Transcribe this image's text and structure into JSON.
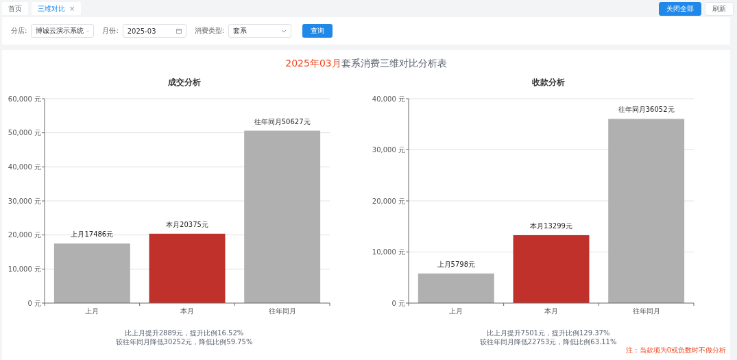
{
  "tabs": [
    {
      "label": "首页",
      "selected": false
    },
    {
      "label": "三维对比",
      "selected": true,
      "close_icon": "×"
    }
  ],
  "tab_actions": [
    {
      "label": "关闭全部",
      "kind": "primary"
    },
    {
      "label": "刷新",
      "kind": "plain"
    }
  ],
  "filters": [
    {
      "label": "分店:",
      "kind": "select",
      "value": "博诚云演示系统"
    },
    {
      "label": "月份:",
      "kind": "date",
      "value": "2025-03"
    },
    {
      "label": "消费类型:",
      "kind": "select",
      "value": "套系"
    }
  ],
  "query_button": "查询",
  "report_title": {
    "highlight": "2025年03月",
    "text": "套系消费三维对比分析表"
  },
  "charts": [
    {
      "chart_data": {
        "type": "bar",
        "title": "成交分析",
        "categories": [
          "上月",
          "本月",
          "往年同月"
        ],
        "stacked": true,
        "grid": true,
        "series": [
          {
            "color": "#afb0af",
            "values": [
              17486,
              null,
              50627
            ]
          },
          {
            "color": "#c1312c",
            "values": [
              null,
              20375,
              null
            ]
          }
        ],
        "value_labels": [
          "上月17486元",
          "本月20375元",
          "往年同月50627元"
        ],
        "ylim": [
          0,
          60000
        ],
        "yticks": [
          {
            "value": 0,
            "label": "0 元"
          },
          {
            "value": 10000,
            "label": "10,000 元"
          },
          {
            "value": 20000,
            "label": "20,000 元"
          },
          {
            "value": 30000,
            "label": "30,000 元"
          },
          {
            "value": 40000,
            "label": "40,000 元"
          },
          {
            "value": 50000,
            "label": "50,000 元"
          },
          {
            "value": 60000,
            "label": "60,000 元"
          }
        ]
      },
      "summary": [
        "比上月提升2889元，提升比例16.52%",
        "较往年同月降低30252元，降低比例59.75%"
      ]
    },
    {
      "chart_data": {
        "type": "bar",
        "title": "收款分析",
        "categories": [
          "上月",
          "本月",
          "往年同月"
        ],
        "stacked": true,
        "grid": true,
        "series": [
          {
            "color": "#afb0af",
            "values": [
              5798,
              null,
              36052
            ]
          },
          {
            "color": "#c1312c",
            "values": [
              null,
              13299,
              null
            ]
          }
        ],
        "value_labels": [
          "上月5798元",
          "本月13299元",
          "往年同月36052元"
        ],
        "ylim": [
          0,
          40000
        ],
        "yticks": [
          {
            "value": 0,
            "label": "0 元"
          },
          {
            "value": 10000,
            "label": "10,000 元"
          },
          {
            "value": 20000,
            "label": "20,000 元"
          },
          {
            "value": 30000,
            "label": "30,000 元"
          },
          {
            "value": 40000,
            "label": "40,000 元"
          }
        ]
      },
      "summary": [
        "比上月提升7501元，提升比例129.37%",
        "较往年同月降低22753元，降低比例63.11%"
      ]
    }
  ],
  "note": "注：当款项为0或负数时不做分析"
}
